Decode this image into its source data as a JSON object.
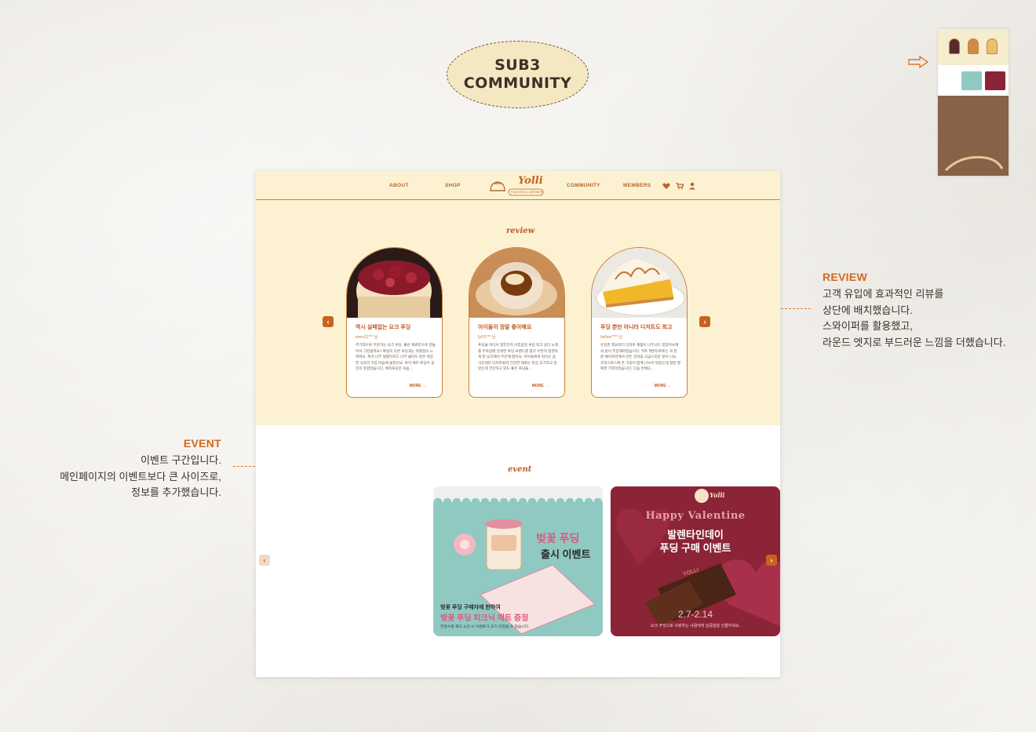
{
  "badge": {
    "line1": "SUB3",
    "line2": "COMMUNITY"
  },
  "annotations": {
    "review": {
      "heading": "REVIEW",
      "lines": [
        "고객 유입에 효과적인 리뷰를",
        "상단에 배치했습니다.",
        "스와이퍼를 활용했고,",
        "라운드 엣지로 부드러운 느낌을 더했습니다."
      ]
    },
    "event": {
      "heading": "EVENT",
      "lines": [
        "이벤트 구간입니다.",
        "메인페이지의 이벤트보다 큰 사이즈로,",
        "정보를 추가했습니다."
      ]
    }
  },
  "nav": {
    "about": "ABOUT",
    "shop": "SHOP",
    "logo": "Yolli",
    "logo_sub": "PUDDING & DESSERT",
    "community": "COMMUNITY",
    "members": "MEMBERS",
    "icons": [
      "heart-icon",
      "cart-icon",
      "user-icon"
    ]
  },
  "review": {
    "title": "review",
    "more": "MORE →",
    "cards": [
      {
        "title": "역시 실패없는 요크 푸딩",
        "user": "even21*** 님",
        "body": "추기적으로 주문하는 요크 푸딩, 좋은 재료만으로 만들어서 그런걸까요? 확실히 다른 푸딩과는 차별점이 느껴져요. 특히 너무 탱탱하지도 너무 물러도 않은 적당한 식감이 가장 마음에 들었어요. 특히 체리 푸딩이 굉장히 맛있었습니다, 체리푸딩은 처음..."
      },
      {
        "title": "아이들이 정말 좋아해요",
        "user": "fyi15*** 님",
        "body": "푸딩을 어디서 접한건지 아후중일 푸딩 먹고 싶다 노래를 부르길래 검색한 푸딩 브랜드를 찾다 우연히 발견하게 된 요크에서 주문해 봤어요. 아이들에게 먹이는 음식인데다 디저트류라 건강한 재료는 반갑 초기하고 있었는데 건강하고 맛도 좋은 푸딩을..."
      },
      {
        "title": "푸딩 뿐만 아니라 디저트도 최고",
        "user": "hellow**** 님",
        "body": "유일한 회요미디 디저트 제품이 너무너도 맛있어보여서 같이 주문해버렸습니다. 키트 케론타르트는 꼭 한 분 베이커리에서 만든 것처럼 고급스러운 맛이 나요. 코리스마스에 온 가족이 함께 나누어 먹었는데 정말 행복한 기억이었습니다. 다음 번에도..."
      }
    ]
  },
  "event": {
    "title": "event",
    "card1": {
      "title": "벚꽃 푸딩",
      "sub": "출시 이벤트",
      "small1": "벚꽃 푸딩 구매자에 한하여",
      "small2": "벚꽃 푸딩 피크닉 매트 증정",
      "small3": "한정수량 재고 소진 시 이벤트가 조기 마감될 수 있습니다."
    },
    "card2": {
      "brand": "Yolli",
      "happy": "Happy Valentine",
      "line1": "발렌타인데이",
      "line2": "푸딩 구매 이벤트",
      "choc": "YOLLI",
      "date": "2.7-2.14",
      "small": "요크 푸딩으로 사랑하는 사람에게 달콤함을 선물하세요."
    }
  },
  "colors": {
    "accent": "#c8621f",
    "cream": "#fcf2d2",
    "valentine": "#8b2436",
    "mint": "#8fc9c2"
  }
}
